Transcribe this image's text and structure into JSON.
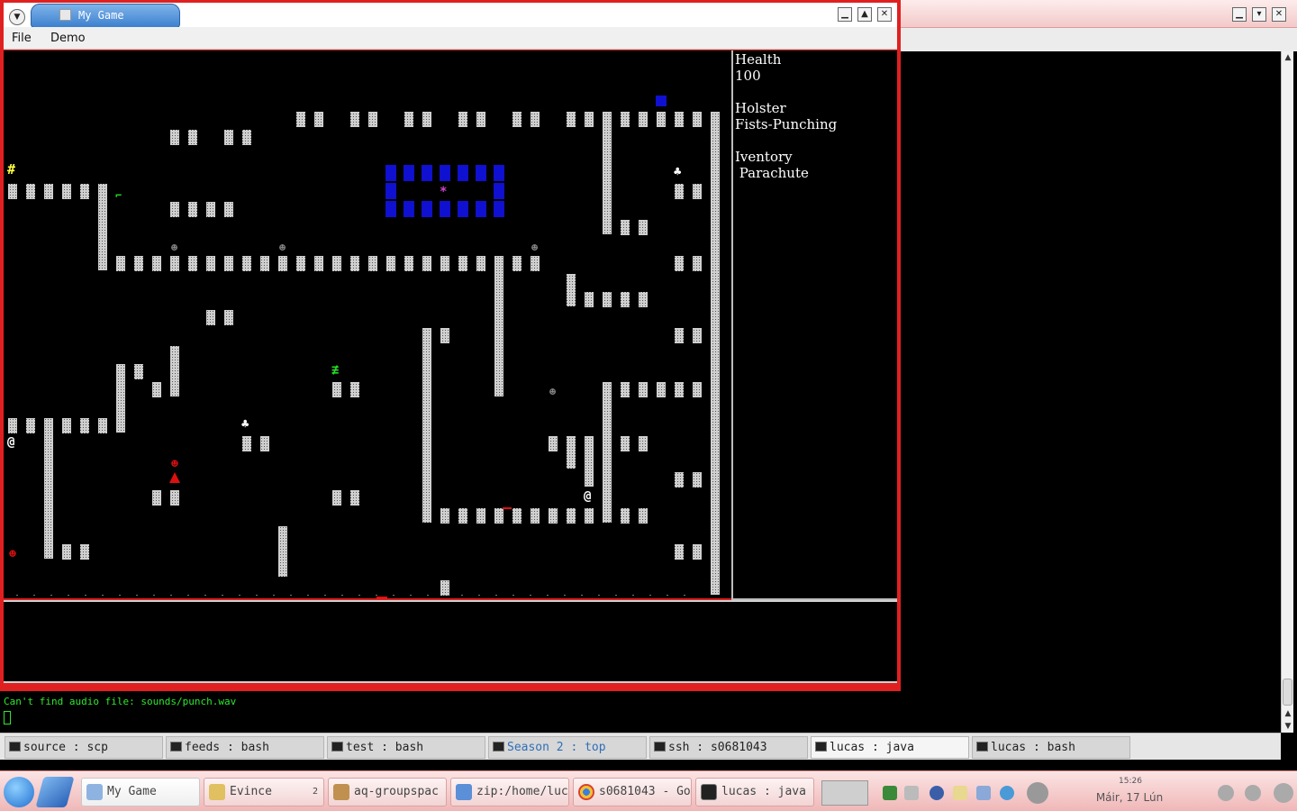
{
  "game_window": {
    "title": "My Game",
    "menu": [
      "File",
      "Demo"
    ],
    "status": {
      "health_label": "Health",
      "health_value": "100",
      "holster_label": "Holster",
      "holster_value": "Fists-Punching",
      "inventory_label": "Iventory",
      "inventory_items": [
        " Parachute"
      ]
    },
    "map_glyphs": {
      "player": "@",
      "exit": "#",
      "item": "♣",
      "enemy": "☻",
      "fire": "≢",
      "door": "⌐"
    },
    "colors": {
      "wall": "#cfcfcf",
      "water": "#1010d0",
      "exit": "#ffff40",
      "fire": "#22dd22",
      "enemy": "#dd1010",
      "frame": "#e02020"
    }
  },
  "terminal": {
    "output_line": "Can't find audio file: sounds/punch.wav",
    "tabs": [
      {
        "label": "source : scp",
        "active": false
      },
      {
        "label": "feeds : bash",
        "active": false
      },
      {
        "label": "test : bash",
        "active": false
      },
      {
        "label": "Season 2 : top",
        "active": false
      },
      {
        "label": "ssh : s0681043",
        "active": false
      },
      {
        "label": "lucas : java",
        "active": true
      },
      {
        "label": "lucas : bash",
        "active": false
      }
    ]
  },
  "taskbar": {
    "tasks": [
      {
        "label": "My Game",
        "active": true,
        "icon_color": "#8fb3e0"
      },
      {
        "label": "Evince",
        "active": false,
        "icon_color": "#e0c060"
      },
      {
        "label": "aq-groupspac",
        "active": false,
        "icon_color": "#c09050"
      },
      {
        "label": "zip:/home/luc",
        "active": false,
        "icon_color": "#5b8fd8"
      },
      {
        "label": "s0681043 - Go",
        "active": false,
        "icon_color": "#d84030"
      },
      {
        "label": "lucas : java",
        "active": false,
        "icon_color": "#222222"
      }
    ],
    "group_count": "2",
    "clock_time": "15:26",
    "clock_date": "Máir, 17 Lún"
  }
}
